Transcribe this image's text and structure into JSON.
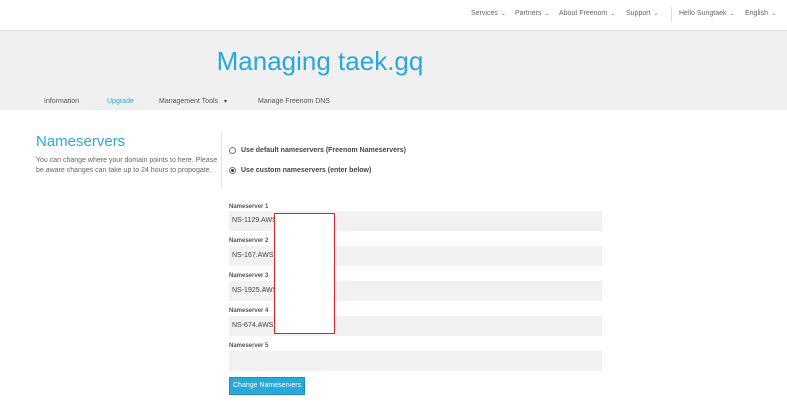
{
  "topnav": {
    "items": [
      {
        "label": "Services"
      },
      {
        "label": "Partners"
      },
      {
        "label": "About Freenom"
      },
      {
        "label": "Support"
      },
      {
        "label": "Hello Sungtaek"
      },
      {
        "label": "English"
      }
    ]
  },
  "hero": {
    "title": "Managing taek.gq"
  },
  "tabs": [
    {
      "label": "Information"
    },
    {
      "label": "Upgrade"
    },
    {
      "label": "Management Tools"
    },
    {
      "label": "Manage Freenom DNS"
    }
  ],
  "sidebar": {
    "title": "Nameservers",
    "description": "You can change where your domain points to here. Please be aware changes can take up to 24 hours to propogate."
  },
  "options": {
    "default_label": "Use default nameservers (Freenom Nameservers)",
    "custom_label": "Use custom nameservers (enter below)",
    "selected": "custom"
  },
  "nameservers": [
    {
      "label": "Nameserver 1",
      "value": "NS-1129.AWS"
    },
    {
      "label": "Nameserver 2",
      "value": "NS-167.AWS"
    },
    {
      "label": "Nameserver 3",
      "value": "NS-1925.AWS"
    },
    {
      "label": "Nameserver 4",
      "value": "NS-674.AWS"
    },
    {
      "label": "Nameserver 5",
      "value": ""
    }
  ],
  "submit": {
    "label": "Change Nameservers"
  },
  "colors": {
    "accent": "#29a9d8",
    "redaction_border": "#d8232a",
    "hero_bg": "#f0f0f0",
    "input_bg": "#f1f1f1"
  }
}
